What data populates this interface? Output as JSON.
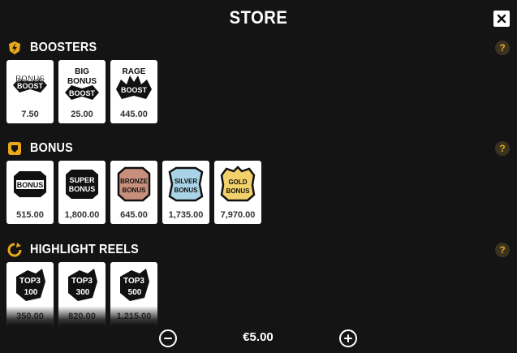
{
  "header": {
    "title": "STORE"
  },
  "sections": [
    {
      "title": "BOOSTERS",
      "help": "?",
      "items": [
        {
          "art_lines": [
            "BONUS",
            "BOOST"
          ],
          "price": "7.50"
        },
        {
          "art_lines": [
            "BIG",
            "BONUS",
            "BOOST"
          ],
          "price": "25.00"
        },
        {
          "art_lines": [
            "RAGE",
            "BOOST"
          ],
          "price": "445.00"
        }
      ]
    },
    {
      "title": "BONUS",
      "help": "?",
      "items": [
        {
          "art_lines": [
            "BONUS"
          ],
          "price": "515.00"
        },
        {
          "art_lines": [
            "SUPER",
            "BONUS"
          ],
          "price": "1,800.00"
        },
        {
          "art_lines": [
            "BRONZE",
            "BONUS"
          ],
          "price": "645.00"
        },
        {
          "art_lines": [
            "SILVER",
            "BONUS"
          ],
          "price": "1,735.00"
        },
        {
          "art_lines": [
            "GOLD",
            "BONUS"
          ],
          "price": "7,970.00"
        }
      ]
    },
    {
      "title": "HIGHLIGHT REELS",
      "help": "?",
      "items": [
        {
          "art_lines": [
            "TOP3",
            "100"
          ],
          "price": "350.00"
        },
        {
          "art_lines": [
            "TOP3",
            "300"
          ],
          "price": "820.00"
        },
        {
          "art_lines": [
            "TOP3",
            "500"
          ],
          "price": "1,215.00"
        }
      ]
    }
  ],
  "footer": {
    "bet": "€5.00"
  },
  "icons": {
    "close": "close-icon",
    "boosters": "bolt-badge-icon",
    "bonus": "shield-icon",
    "highlight_reels": "refresh-arrow-icon",
    "decrease": "minus-circle-icon",
    "increase": "plus-circle-icon"
  },
  "colors": {
    "accent": "#e9a81a",
    "background": "#141414",
    "card": "#ffffff",
    "bronze": "#c98f7d",
    "silver": "#a9d3e6",
    "gold": "#f2d16b"
  }
}
